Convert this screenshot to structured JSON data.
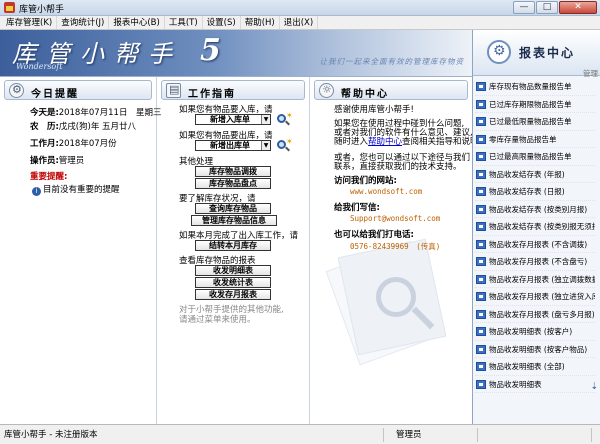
{
  "window": {
    "title": "库管小帮手",
    "minimize": "—",
    "maximize": "□",
    "close": "✕"
  },
  "menu": [
    "库存管理(K)",
    "查询统计(J)",
    "报表中心(B)",
    "工具(T)",
    "设置(S)",
    "帮助(H)",
    "退出(X)"
  ],
  "banner": {
    "brand": "库管小帮手",
    "version": "5",
    "sub": "Wondersoft",
    "slogan": "让我们一起来全面有效的管理库存物资"
  },
  "today": {
    "title": "今日提醒",
    "today_label": "今天是:",
    "today_value": "2018年07月11日　星期三",
    "lunar_label": "农　历:",
    "lunar_value": "戊戌(狗)年 五月廿八",
    "workmonth_label": "工作月:",
    "workmonth_value": "2018年07月份",
    "operator_label": "操作员:",
    "operator_value": "管理员",
    "important_label": "重要提醒:",
    "important_item": "目前没有重要的提醒"
  },
  "guide": {
    "title": "工作指南",
    "in_text": "如果您有物品要入库，请",
    "in_button": "新增入库单",
    "out_text": "如果您有物品要出库，请",
    "out_button": "新增出库单",
    "other_text": "其他处理",
    "adjust_button": "库存物品调拨",
    "check_button": "库存物品盘点",
    "learn_text": "要了解库存状况，请",
    "query_button": "查询库存物品",
    "manage_button": "管理库存物品信息",
    "month_text": "如果本月完成了出入库工作，请",
    "carry_button": "结转本月库存",
    "report_text": "查看库存物品的报表",
    "detail_button": "收发明细表",
    "stat_button": "收发统计表",
    "monthly_button": "收发存月报表",
    "footer": "对于小帮手提供的其他功能,请通过菜单来使用。"
  },
  "help": {
    "title": "帮助中心",
    "thanks": "感谢使用库管小帮手!",
    "p1a": "如果您在使用过程中碰到什么问题,",
    "p1b": "或者对我们的软件有什么意见、建议,",
    "p1c": "随时进入",
    "p1_link": "帮助中心",
    "p1d": "查阅相关指导和说明。",
    "p2a": "或者，您也可以通过以下途径与我们",
    "p2b": "联系，直接获取我们的技术支持。",
    "web_label": "访问我们的网站:",
    "web_value": "www.wondsoft.com",
    "mail_label": "给我们写信:",
    "mail_value": "Support@wondsoft.com",
    "phone_label": "也可以给我们打电话:",
    "phone_value": "0576-82439969　(传真)"
  },
  "sidebar": {
    "title": "报表中心",
    "tool_link": "管理",
    "items": [
      "库存现有物品数量报告单",
      "已过库存期限物品报告单",
      "已过最低限量物品报告单",
      "零库存量物品报告单",
      "已过最高限量物品报告单",
      "物品收发结存表 (年报)",
      "物品收发结存表 (日报)",
      "物品收发结存表 (按类别月报)",
      "物品收发结存表 (按类别报无须报)",
      "物品收发存月报表 (不含调拨)",
      "物品收发存月报表 (不含盘亏)",
      "物品收发存月报表 (独立调拨数据)",
      "物品收发存月报表 (独立进货入库)",
      "物品收发存月报表 (盘亏多月报)",
      "物品收发明细表 (按客户)",
      "物品收发明细表 (按客户物品)",
      "物品收发明细表 (全部)",
      "物品收发明细表"
    ]
  },
  "status": {
    "app": "库管小帮手 - 未注册版本",
    "user": "管理员",
    "extra": ""
  }
}
